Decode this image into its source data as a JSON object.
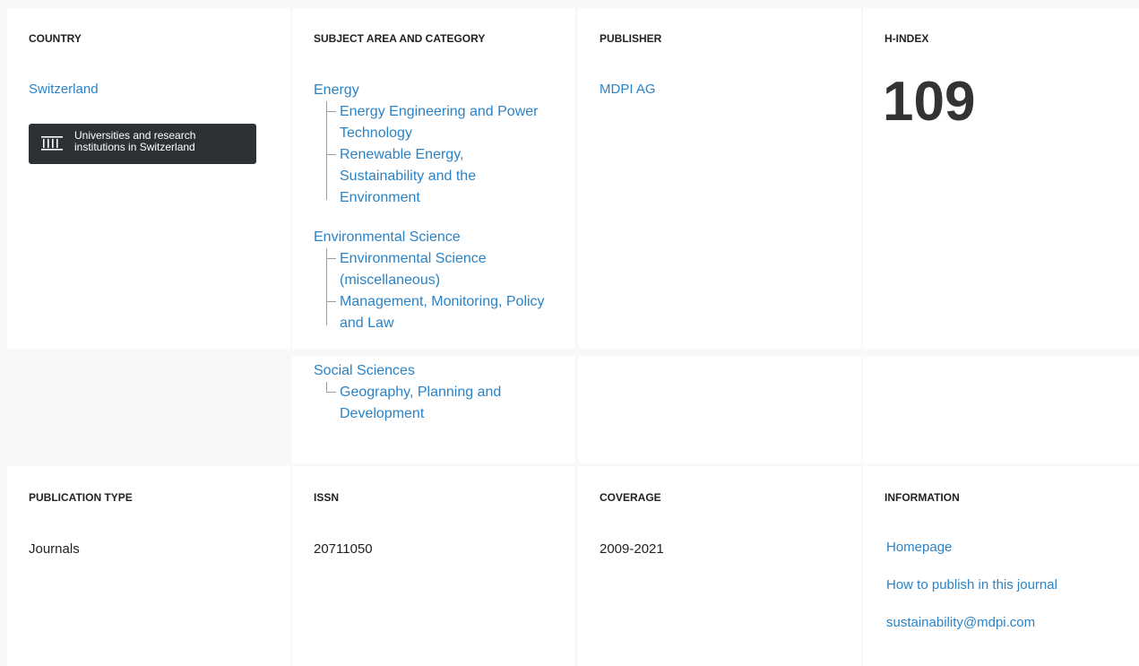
{
  "country": {
    "header": "COUNTRY",
    "value": "Switzerland",
    "institutions_button": {
      "line1": "Universities and research",
      "line2": "institutions in Switzerland",
      "icon": "institution-icon"
    }
  },
  "subject": {
    "header": "SUBJECT AREA AND CATEGORY",
    "areas": [
      {
        "name": "Energy",
        "categories": [
          "Energy Engineering and Power Technology",
          "Renewable Energy, Sustainability and the Environment"
        ]
      },
      {
        "name": "Environmental Science",
        "categories": [
          "Environmental Science (miscellaneous)",
          "Management, Monitoring, Policy and Law"
        ]
      },
      {
        "name": "Social Sciences",
        "categories": [
          "Geography, Planning and Development"
        ]
      }
    ]
  },
  "publisher": {
    "header": "PUBLISHER",
    "value": "MDPI AG"
  },
  "hindex": {
    "header": "H-INDEX",
    "value": "109"
  },
  "publication_type": {
    "header": "PUBLICATION TYPE",
    "value": "Journals"
  },
  "issn": {
    "header": "ISSN",
    "value": "20711050"
  },
  "coverage": {
    "header": "COVERAGE",
    "value": "2009-2021"
  },
  "information": {
    "header": "INFORMATION",
    "links": [
      "Homepage",
      "How to publish in this journal",
      "sustainability@mdpi.com"
    ]
  },
  "colors": {
    "link": "#2a83c6",
    "button_bg": "#2e3134",
    "text": "#222222"
  }
}
